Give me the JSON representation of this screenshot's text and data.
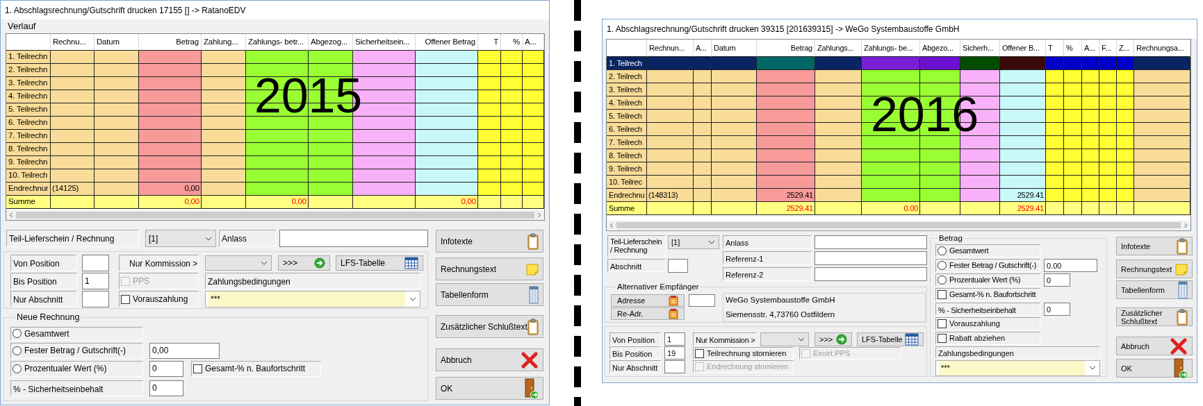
{
  "left_window": {
    "title": "1. Abschlagsrechnung/Gutschrift drucken 17155 [] -> RatanoEDV",
    "section_title": "Verlauf",
    "overlay_label": "2015",
    "grid": {
      "columns": [
        {
          "label": "Rechnu...",
          "color": "#f8dc98"
        },
        {
          "label": "Datum",
          "color": "#f8dc98"
        },
        {
          "label": "Betrag",
          "color": "#f89a9a",
          "numeric": true
        },
        {
          "label": "Zahlung...",
          "color": "#f8dc98"
        },
        {
          "label": "Zahlungs- betr...",
          "color": "#99ff33"
        },
        {
          "label": "Abgezog...",
          "color": "#99ff33"
        },
        {
          "label": "Sicherheitsein...",
          "color": "#f8b0f8"
        },
        {
          "label": "Offener Betrag",
          "color": "#c8f8f8",
          "numeric": true
        },
        {
          "label": "T",
          "color": "#ffff33",
          "numeric": true
        },
        {
          "label": "%",
          "color": "#ffff33",
          "numeric": true
        },
        {
          "label": "A...",
          "color": "#ffff33"
        }
      ],
      "rows": [
        {
          "label": "1. Teilrechn",
          "kind": "part",
          "selected": false
        },
        {
          "label": "2. Teilrechn",
          "kind": "part",
          "selected": false
        },
        {
          "label": "3. Teilrechn",
          "kind": "part",
          "selected": false
        },
        {
          "label": "4. Teilrechn",
          "kind": "part",
          "selected": false
        },
        {
          "label": "5. Teilrechn",
          "kind": "part",
          "selected": false
        },
        {
          "label": "6. Teilrechn",
          "kind": "part",
          "selected": false
        },
        {
          "label": "7. Teilrechn",
          "kind": "part",
          "selected": false
        },
        {
          "label": "8. Teilrechn",
          "kind": "part",
          "selected": false
        },
        {
          "label": "9. Teilrechn",
          "kind": "part",
          "selected": false
        },
        {
          "label": "10. Teilrech",
          "kind": "part",
          "selected": false
        },
        {
          "label": "Endrechnur",
          "kind": "final",
          "selected": false,
          "cells": [
            "(14125)",
            null,
            "0,00"
          ]
        },
        {
          "label": "Summe",
          "kind": "total",
          "selected": false,
          "cells": [
            null,
            null,
            "0,00",
            null,
            "0,00",
            null,
            null,
            "0,00"
          ]
        }
      ]
    },
    "delivery_note": {
      "label": "Teil-Lieferschein / Rechnung",
      "value": "[1]"
    },
    "occasion": {
      "label": "Anlass"
    },
    "from_position": {
      "label": "Von Position"
    },
    "to_position": {
      "label": "Bis Position",
      "value": "1"
    },
    "section_only": {
      "label": "Nur Abschnitt"
    },
    "commission": {
      "label": "Nur Kommission >"
    },
    "go_button": ">>>",
    "lfs_button": "LFS-Tabelle",
    "pps": {
      "label": "PPS",
      "checked": false,
      "disabled": true
    },
    "prepayment": {
      "label": "Vorauszahlung",
      "checked": false,
      "disabled": false
    },
    "payment_terms": {
      "label": "Zahlungsbedingungen",
      "value": "***"
    },
    "new_invoice": {
      "title": "Neue Rechnung",
      "options": [
        {
          "label": "Gesamtwert",
          "selected": false
        },
        {
          "label": "Fester Betrag / Gutschrift(-)",
          "selected": false,
          "value": "0,00"
        },
        {
          "label": "Prozentualer Wert (%)",
          "selected": false,
          "value": "0"
        }
      ],
      "progress": {
        "label": "Gesamt-% n. Baufortschritt",
        "checked": false,
        "disabled": false
      },
      "retention": {
        "label": "% - Sicherheitseinbehalt",
        "value": "0"
      }
    },
    "buttons": [
      {
        "label": "Infotexte"
      },
      {
        "label": "Rechnungstext"
      },
      {
        "label": "Tabellenform"
      },
      {
        "label": "Zusätzlicher Schlußtext"
      },
      {
        "label": "Abbruch"
      },
      {
        "label": "OK"
      }
    ]
  },
  "right_window": {
    "title": "1. Abschlagsrechnung/Gutschrift drucken 39315 [201639315] -> WeGo Systembaustoffe GmbH",
    "overlay_label": "2016",
    "grid": {
      "columns": [
        {
          "label": "Rechnun...",
          "color": "#f8dc98",
          "highlight": {
            "color": "#0a2463"
          }
        },
        {
          "label": "A...",
          "color": "#f8dc98",
          "highlight": {
            "color": "#0a2463"
          }
        },
        {
          "label": "Datum",
          "color": "#f8dc98",
          "highlight": {
            "color": "#0a2463"
          }
        },
        {
          "label": "Betrag",
          "color": "#f89a9a",
          "numeric": true,
          "highlight": {
            "color": "#006666"
          }
        },
        {
          "label": "Zahlungs...",
          "color": "#f8dc98",
          "highlight": {
            "color": "#0a2463"
          }
        },
        {
          "label": "Zahlungs- be...",
          "color": "#99ff33",
          "highlight": {
            "color": "#7a1ed8"
          }
        },
        {
          "label": "Abgezo...",
          "color": "#99ff33",
          "highlight": {
            "color": "#6a10d0"
          }
        },
        {
          "label": "Sicherh...",
          "color": "#f8b0f8",
          "highlight": {
            "color": "#004d00"
          }
        },
        {
          "label": "Offener B...",
          "color": "#c8f8f8",
          "highlight": {
            "color": "#3a0a0a"
          }
        },
        {
          "label": "T",
          "color": "#ffff33",
          "highlight": {
            "color": "#0000c8"
          }
        },
        {
          "label": "%",
          "color": "#ffff33",
          "highlight": {
            "color": "#0000c8"
          }
        },
        {
          "label": "A...",
          "color": "#ffff33",
          "highlight": {
            "color": "#0000c8"
          }
        },
        {
          "label": "F...",
          "color": "#ffff33",
          "highlight": {
            "color": "#0000c8"
          }
        },
        {
          "label": "Z...",
          "color": "#ffff33",
          "highlight": {
            "color": "#0000c8"
          }
        },
        {
          "label": "Rechnungsa...",
          "color": "#f8dc98",
          "highlight": {
            "color": "#0a2463"
          }
        }
      ],
      "rows": [
        {
          "label": "1. Teilrech",
          "kind": "part",
          "selected": true
        },
        {
          "label": "2. Teilrech",
          "kind": "part",
          "selected": false
        },
        {
          "label": "3. Teilrech",
          "kind": "part",
          "selected": false
        },
        {
          "label": "4. Teilrech",
          "kind": "part",
          "selected": false
        },
        {
          "label": "5. Teilrech",
          "kind": "part",
          "selected": false
        },
        {
          "label": "6. Teilrech",
          "kind": "part",
          "selected": false
        },
        {
          "label": "7. Teilrech",
          "kind": "part",
          "selected": false
        },
        {
          "label": "8. Teilrech",
          "kind": "part",
          "selected": false
        },
        {
          "label": "9. Teilrech",
          "kind": "part",
          "selected": false
        },
        {
          "label": "10. Teilrec",
          "kind": "part",
          "selected": false
        },
        {
          "label": "Endrechnu",
          "kind": "final",
          "selected": false,
          "cells": [
            "(148313)",
            null,
            null,
            "2529.41",
            null,
            null,
            null,
            null,
            "2529.41"
          ]
        },
        {
          "label": "Summe",
          "kind": "total",
          "selected": false,
          "cells": [
            null,
            null,
            null,
            "2529.41",
            null,
            "0.00",
            null,
            null,
            "2529.41"
          ]
        }
      ]
    },
    "delivery_note": {
      "label": "Teil-Lieferschein / Rechnung",
      "value": "[1]"
    },
    "section": {
      "label": "Abschnitt"
    },
    "reference_fields": [
      {
        "label": "Anlass"
      },
      {
        "label": "Referenz-1"
      },
      {
        "label": "Referenz-2"
      }
    ],
    "alternative_recipient": {
      "title": "Alternativer Empfänger",
      "address_button": "Adresse",
      "readdress_button": "Re-Adr.",
      "address_lines": [
        "WeGo Systembaustoffe GmbH",
        "Siemensstr. 4,73760 Ostfildern"
      ]
    },
    "from_position": {
      "label": "Von Position",
      "value": "1"
    },
    "to_position": {
      "label": "Bis Position",
      "value": "19"
    },
    "section_only": {
      "label": "Nur Abschnitt"
    },
    "commission": {
      "label": "Nur Kommission >"
    },
    "go_button": ">>>",
    "lfs_button": "LFS-Tabelle",
    "cancel_partial": {
      "label": "Teilrechnung stornieren",
      "checked": false,
      "disabled": false
    },
    "cancel_final": {
      "label": "Endrechnung stornieren",
      "checked": false,
      "disabled": true
    },
    "export_pps": {
      "label": "Exoirt PPS",
      "checked": false,
      "disabled": true
    },
    "amount": {
      "title": "Betrag",
      "options": [
        {
          "label": "Gesamtwert",
          "selected": false
        },
        {
          "label": "Fester Betrag / Gutschrift(-)",
          "selected": false,
          "value": "0.00"
        },
        {
          "label": "Prozentualer Wert (%)",
          "selected": false,
          "value": "0"
        }
      ],
      "progress": {
        "label": "Gesamt-% n. Baufortschritt",
        "checked": false,
        "disabled": false
      },
      "retention": {
        "label": "% - Sicherheitseinbehalt",
        "value": "0"
      },
      "prepayment": {
        "label": "Vorauszahlung",
        "checked": false,
        "disabled": false
      },
      "discount": {
        "label": "Rabatt abziehen",
        "checked": false,
        "disabled": false
      },
      "payment_terms": {
        "label": "Zahlungsbedingungen",
        "value": "***"
      }
    },
    "buttons": [
      {
        "label": "Infotexte"
      },
      {
        "label": "Rechnungstext"
      },
      {
        "label": "Tabellenform"
      },
      {
        "label": "Zusätzlicher Schlußtext"
      },
      {
        "label": "Abbruch"
      },
      {
        "label": "OK"
      }
    ]
  }
}
